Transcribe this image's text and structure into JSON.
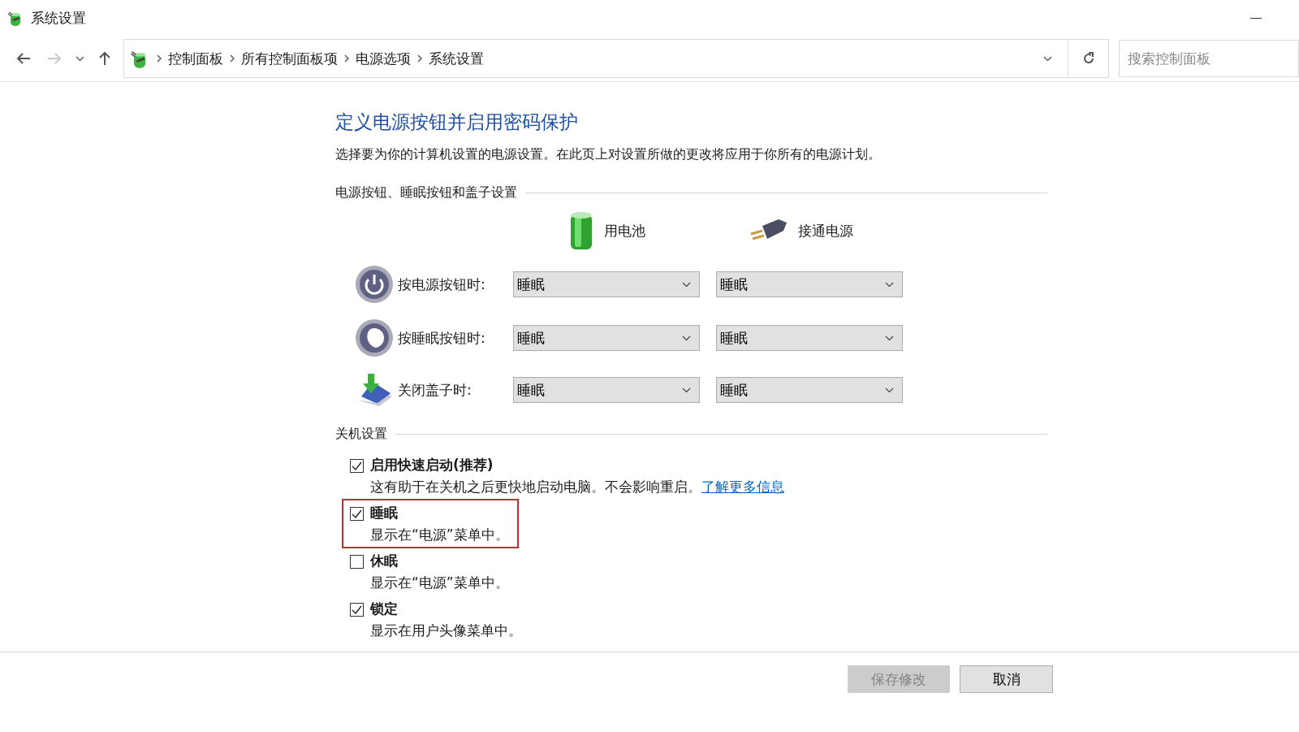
{
  "window": {
    "title": "系统设置"
  },
  "address_bar": {
    "breadcrumbs": [
      "控制面板",
      "所有控制面板项",
      "电源选项",
      "系统设置"
    ]
  },
  "search": {
    "placeholder": "搜索控制面板"
  },
  "heading": "定义电源按钮并启用密码保护",
  "description": "选择要为你的计算机设置的电源设置。在此页上对设置所做的更改将应用于你所有的电源计划。",
  "buttons_section": {
    "title": "电源按钮、睡眠按钮和盖子设置",
    "columns": [
      {
        "kind": "battery",
        "label": "用电池"
      },
      {
        "kind": "plug",
        "label": "接通电源"
      }
    ],
    "rows": [
      {
        "kind": "power",
        "label": "按电源按钮时:",
        "values": [
          "睡眠",
          "睡眠"
        ]
      },
      {
        "kind": "sleep",
        "label": "按睡眠按钮时:",
        "values": [
          "睡眠",
          "睡眠"
        ]
      },
      {
        "kind": "lid",
        "label": "关闭盖子时:",
        "values": [
          "睡眠",
          "睡眠"
        ]
      }
    ]
  },
  "shutdown_section": {
    "title": "关机设置",
    "options": [
      {
        "label": "启用快速启动(推荐)",
        "checked": true,
        "highlighted": false,
        "description": "这有助于在关机之后更快地启动电脑。不会影响重启。",
        "link": "了解更多信息"
      },
      {
        "label": "睡眠",
        "checked": true,
        "highlighted": true,
        "description": "显示在“电源”菜单中。"
      },
      {
        "label": "休眠",
        "checked": false,
        "highlighted": false,
        "description": "显示在“电源”菜单中。"
      },
      {
        "label": "锁定",
        "checked": true,
        "highlighted": false,
        "description": "显示在用户头像菜单中。"
      }
    ]
  },
  "footer": {
    "buttons": [
      {
        "label": "保存修改",
        "disabled": true
      },
      {
        "label": "取消",
        "disabled": false
      }
    ]
  }
}
